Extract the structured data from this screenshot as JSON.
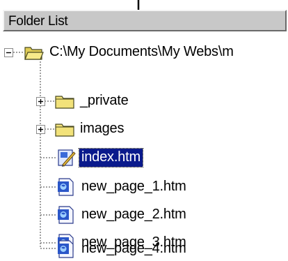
{
  "panel": {
    "title": "Folder List"
  },
  "tree": {
    "root": {
      "label": "C:\\My Documents\\My Webs\\m",
      "icon": "open-folder-icon",
      "expanded": true
    },
    "items": [
      {
        "label": "_private",
        "icon": "folder-icon",
        "expander": "plus"
      },
      {
        "label": "images",
        "icon": "folder-icon",
        "expander": "plus"
      },
      {
        "label": "index.htm",
        "icon": "homepage-file-icon",
        "selected": true
      },
      {
        "label": "new_page_1.htm",
        "icon": "html-file-icon"
      },
      {
        "label": "new_page_2.htm",
        "icon": "html-file-icon"
      },
      {
        "label": "new_page_3.htm",
        "icon": "html-file-icon"
      },
      {
        "label": "new_page_4.htm",
        "icon": "html-file-icon"
      }
    ]
  },
  "colors": {
    "header_bg": "#c8c8c8",
    "selection_bg": "#0a1a8c",
    "folder_yellow": "#f2e27a"
  }
}
